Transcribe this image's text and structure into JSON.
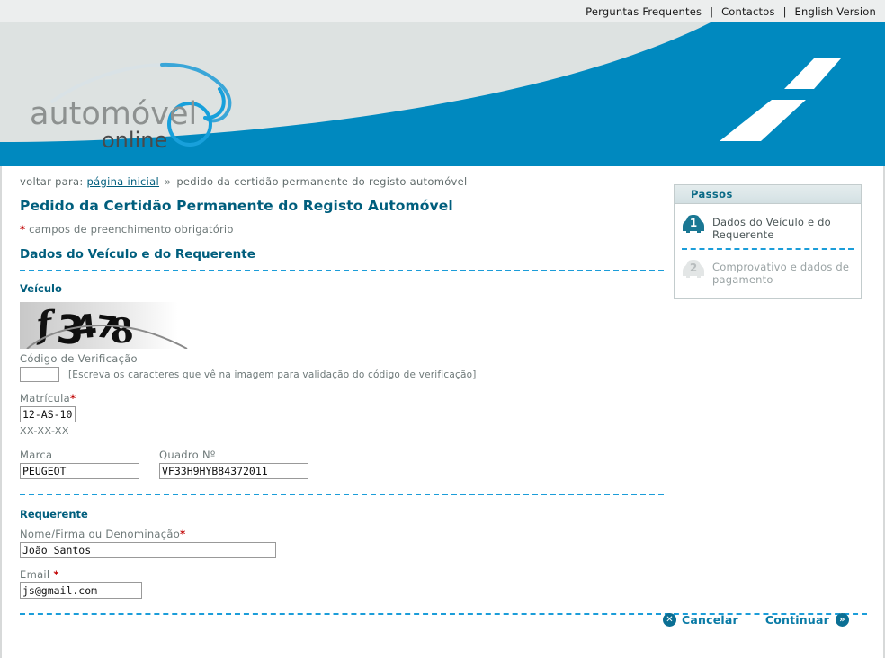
{
  "topbar": {
    "links": [
      "Perguntas Frequentes",
      "Contactos",
      "English Version"
    ],
    "separator": "|"
  },
  "brand": {
    "name_primary": "automóvel",
    "name_secondary": "online",
    "logo_icon": "car-outline-icon",
    "road_icon": "road-graphic"
  },
  "breadcrumb": {
    "prefix": "voltar para:",
    "home_link": "página inicial",
    "chevron": "»",
    "current": "pedido da certidão permanente do registo automóvel"
  },
  "page": {
    "title": "Pedido da Certidão Permanente do Registo Automóvel",
    "required_star": "*",
    "required_note": "campos de preenchimento obrigatório",
    "section_title": "Dados do Veículo e do Requerente"
  },
  "vehicle": {
    "subtitle": "Veículo",
    "captcha": {
      "image_text": "f3478",
      "label": "Código de Verificação",
      "value": "",
      "hint": "[Escreva os caracteres que vê na imagem para validação do código de verificação]"
    },
    "matricula": {
      "label": "Matrícula",
      "required": "*",
      "value": "12-AS-10",
      "format_hint": "XX-XX-XX"
    },
    "marca": {
      "label": "Marca",
      "value": "PEUGEOT"
    },
    "quadro": {
      "label": "Quadro Nº",
      "value": "VF33H9HYB84372011"
    }
  },
  "applicant": {
    "subtitle": "Requerente",
    "nome": {
      "label": "Nome/Firma ou Denominação",
      "required": "*",
      "value": "João Santos"
    },
    "email": {
      "label": "Email ",
      "required": "*",
      "value": "js@gmail.com"
    }
  },
  "actions": {
    "cancel_label": "Cancelar",
    "cancel_icon": "close-circle-icon",
    "continue_label": "Continuar",
    "continue_icon": "double-chevron-right-circle-icon"
  },
  "steps_panel": {
    "header": "Passos",
    "items": [
      {
        "number": "1",
        "label": "Dados do Veículo e do Requerente",
        "state": "active",
        "icon": "car-front-icon"
      },
      {
        "number": "2",
        "label": "Comprovativo e dados de pagamento",
        "state": "inactive",
        "icon": "car-front-icon"
      }
    ]
  },
  "colors": {
    "brand_blue": "#0089bf",
    "dark_teal": "#005e7d",
    "accent_cyan": "#1b9dd9",
    "required_red": "#c00000",
    "banner_gray": "#dde2e1"
  }
}
